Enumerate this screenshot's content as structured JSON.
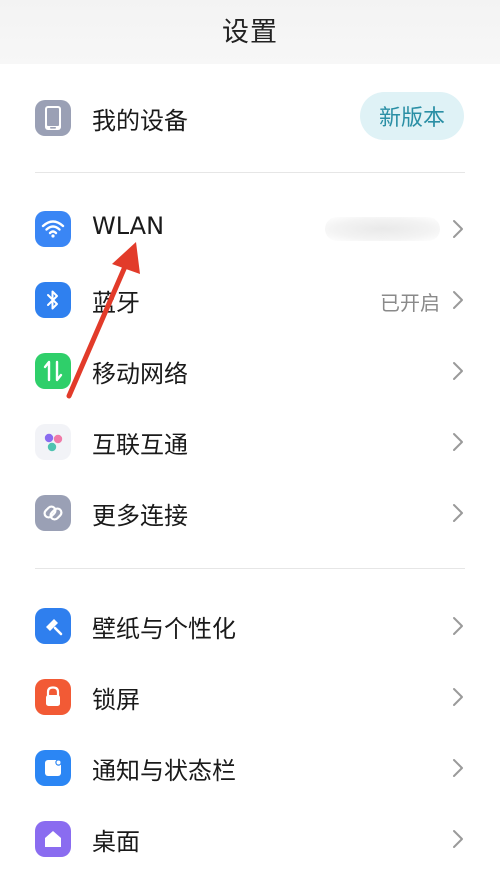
{
  "header": {
    "title": "设置"
  },
  "my_device": {
    "label": "我的设备",
    "badge": "新版本"
  },
  "connectivity": {
    "items": [
      {
        "label": "WLAN",
        "value": ""
      },
      {
        "label": "蓝牙",
        "value": "已开启"
      },
      {
        "label": "移动网络",
        "value": ""
      },
      {
        "label": "互联互通",
        "value": ""
      },
      {
        "label": "更多连接",
        "value": ""
      }
    ]
  },
  "personal": {
    "items": [
      {
        "label": "壁纸与个性化"
      },
      {
        "label": "锁屏"
      },
      {
        "label": "通知与状态栏"
      },
      {
        "label": "桌面"
      }
    ]
  },
  "colors": {
    "wifi": "#3a86f5",
    "bluetooth": "#2f80ef",
    "mobile": "#2fcf6a",
    "device": "#9aa0b5",
    "wallpaper": "#2f7fee",
    "lock": "#f25a35",
    "notify": "#2b86f4",
    "desktop": "#8a6cf0",
    "arrow": "#e23b2a"
  }
}
